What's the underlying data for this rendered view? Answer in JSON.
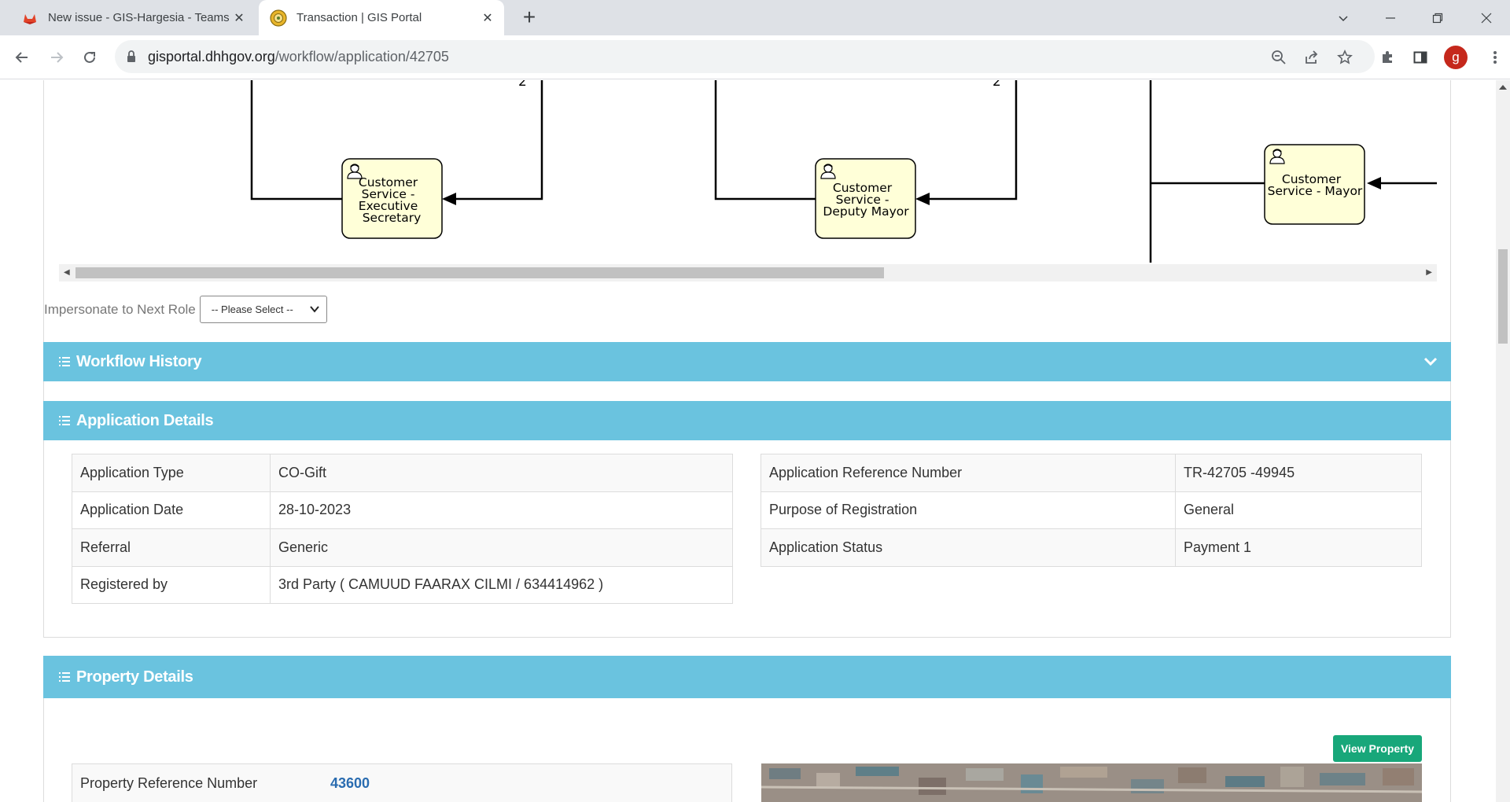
{
  "browser": {
    "tabs": [
      {
        "title": "New issue - GIS-Hargesia - Teams F",
        "active": false,
        "icon": "gitlab-icon"
      },
      {
        "title": "Transaction | GIS Portal",
        "active": true,
        "icon": "portal-logo-icon"
      }
    ],
    "url_host": "gisportal.dhhgov.org",
    "url_path": "/workflow/application/42705",
    "profile_initial": "g"
  },
  "diagram": {
    "nodes": [
      {
        "lines": [
          "Customer",
          "Service -",
          "Executive",
          "Secretary"
        ]
      },
      {
        "lines": [
          "Customer",
          "Service -",
          "Deputy Mayor"
        ]
      },
      {
        "lines": [
          "Customer",
          "Service - Mayor"
        ]
      }
    ],
    "edge_labels": [
      "2",
      "2"
    ]
  },
  "impersonate": {
    "label": "Impersonate to Next Role",
    "selected": "-- Please Select --"
  },
  "sections": {
    "workflow_history": "Workflow History",
    "application_details": "Application Details",
    "property_details": "Property Details"
  },
  "application_left": [
    {
      "label": "Application Type",
      "value": "CO-Gift"
    },
    {
      "label": "Application Date",
      "value": "28-10-2023"
    },
    {
      "label": "Referral",
      "value": "Generic"
    },
    {
      "label": "Registered by",
      "value": "3rd Party ( CAMUUD FAARAX CILMI / 634414962 )"
    }
  ],
  "application_right": [
    {
      "label": "Application Reference Number",
      "value": "TR-42705 -49945"
    },
    {
      "label": "Purpose of Registration",
      "value": "General"
    },
    {
      "label": "Application Status",
      "value": "Payment 1"
    }
  ],
  "property": {
    "view_button": "View Property",
    "ref_label": "Property Reference Number",
    "ref_value": "43600"
  },
  "colors": {
    "section_bar": "#6ac3df",
    "green_button": "#18a77a",
    "task_fill": "#ffffd8"
  }
}
